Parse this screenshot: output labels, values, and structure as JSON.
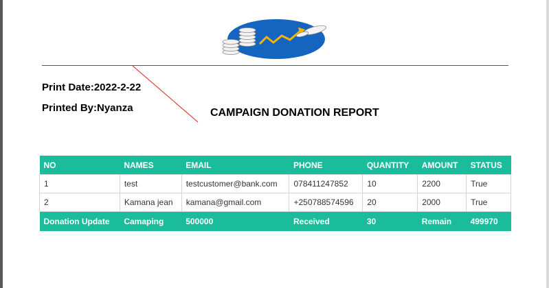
{
  "report": {
    "print_date": "Print Date:2022-2-22",
    "printed_by": "Printed By:Nyanza",
    "title": "CAMPAIGN DONATION REPORT"
  },
  "table": {
    "headers": [
      "NO",
      "NAMES",
      "EMAIL",
      "PHONE",
      "QUANTITY",
      "AMOUNT",
      "STATUS"
    ],
    "rows": [
      [
        "1",
        "test",
        "testcustomer@bank.com",
        "078411247852",
        "10",
        "2200",
        "True"
      ],
      [
        "2",
        "Kamana jean",
        "kamana@gmail.com",
        "+250788574596",
        "20",
        "2000",
        "True"
      ]
    ],
    "footer": [
      "Donation Update",
      "Camaping",
      "500000",
      "Received",
      "30",
      "Remain",
      "499970"
    ]
  },
  "colors": {
    "header_bg": "#1bbc9b",
    "rule": "#e31b1b",
    "logo_ellipse": "#1565c0",
    "logo_arrow": "#f2b705"
  },
  "logo": {
    "icon": "coins-growth-chart-logo"
  }
}
